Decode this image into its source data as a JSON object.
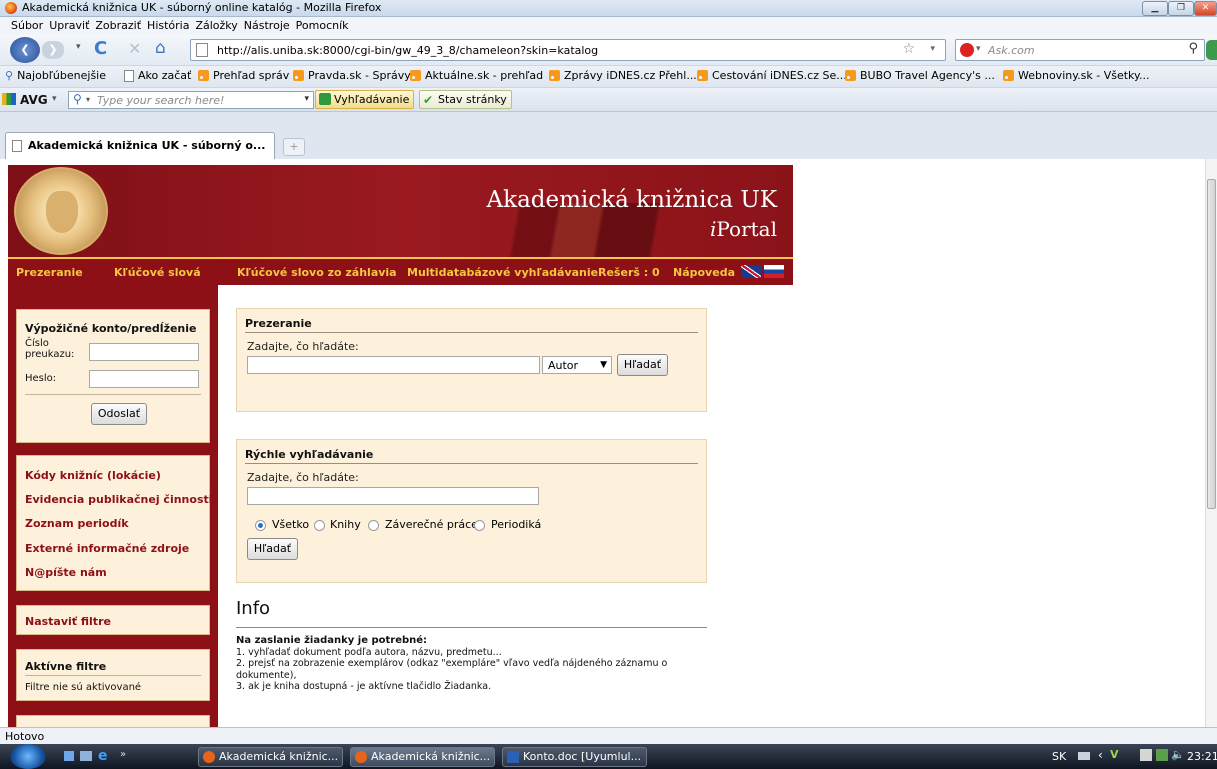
{
  "window": {
    "title": "Akademická knižnica UK - súborný online katalóg - Mozilla Firefox"
  },
  "menu": [
    "Súbor",
    "Upraviť",
    "Zobraziť",
    "História",
    "Záložky",
    "Nástroje",
    "Pomocník"
  ],
  "nav": {
    "url": "http://alis.uniba.sk:8000/cgi-bin/gw_49_3_8/chameleon?skin=katalog",
    "search_placeholder": "Ask.com"
  },
  "bookmarks": [
    "Najobľúbenejšie",
    "Ako začať",
    "Prehľad správ",
    "Pravda.sk - Správy",
    "Aktuálne.sk - prehľad",
    "Zprávy iDNES.cz Přehl...",
    "Cestování iDNES.cz Se...",
    "BUBO Travel Agency's ...",
    "Webnoviny.sk - Všetky..."
  ],
  "avg": {
    "brand": "AVG",
    "search_placeholder": "Type your search here!",
    "search_button": "Vyhľadávanie",
    "status_button": "Stav stránky"
  },
  "tab": {
    "title": "Akademická knižnica UK - súborný o...",
    "new_tab": "+"
  },
  "banner": {
    "name": "Akademická knižnica UK",
    "sub_prefix": "i",
    "sub_rest": "Portal"
  },
  "topnav": [
    "Prezeranie",
    "Kľúčové slová",
    "Kľúčové slovo zo záhlavia",
    "Multidatabázové vyhľadávanie",
    "Rešerš : 0",
    "Nápoveda"
  ],
  "login": {
    "title": "Výpožičné konto/predĺženie",
    "card_label_1": "Číslo",
    "card_label_2": "preukazu:",
    "password_label": "Heslo:",
    "submit": "Odoslať"
  },
  "links": [
    "Kódy knižníc (lokácie)",
    "Evidencia publikačnej činnosti",
    "Zoznam periodík",
    "Externé informačné zdroje",
    "N@píšte nám"
  ],
  "filters": {
    "set": "Nastaviť filtre",
    "active_title": "Aktívne filtre",
    "active_text": "Filtre nie sú aktivované"
  },
  "browse": {
    "title": "Prezeranie",
    "prompt": "Zadajte, čo hľadáte:",
    "select_value": "Autor",
    "button": "Hľadať"
  },
  "quick": {
    "title": "Rýchle vyhľadávanie",
    "prompt": "Zadajte, čo hľadáte:",
    "options": [
      "Všetko",
      "Knihy",
      "Záverečné práce",
      "Periodiká"
    ],
    "selected": "Všetko",
    "button": "Hľadať"
  },
  "info": {
    "title": "Info",
    "lead": "Na zaslanie žiadanky je potrebné:",
    "line1": "1. vyhľadať dokument podľa autora, názvu, predmetu...",
    "line2": "2. prejsť na zobrazenie exemplárov (odkaz \"exempláre\" vľavo vedľa nájdeného záznamu o",
    "line2b": "dokumente),",
    "line3": "3. ak je kniha dostupná - je aktívne tlačidlo Žiadanka."
  },
  "status": "Hotovo",
  "taskbar": {
    "tasks": [
      "Akademická knižnic...",
      "Akademická knižnic...",
      "Konto.doc [Uyumlul..."
    ],
    "lang": "SK",
    "clock": "23:21"
  },
  "colors": {
    "maroon": "#8d1017",
    "gold": "#f7c641",
    "panel": "#fdf1dc"
  }
}
